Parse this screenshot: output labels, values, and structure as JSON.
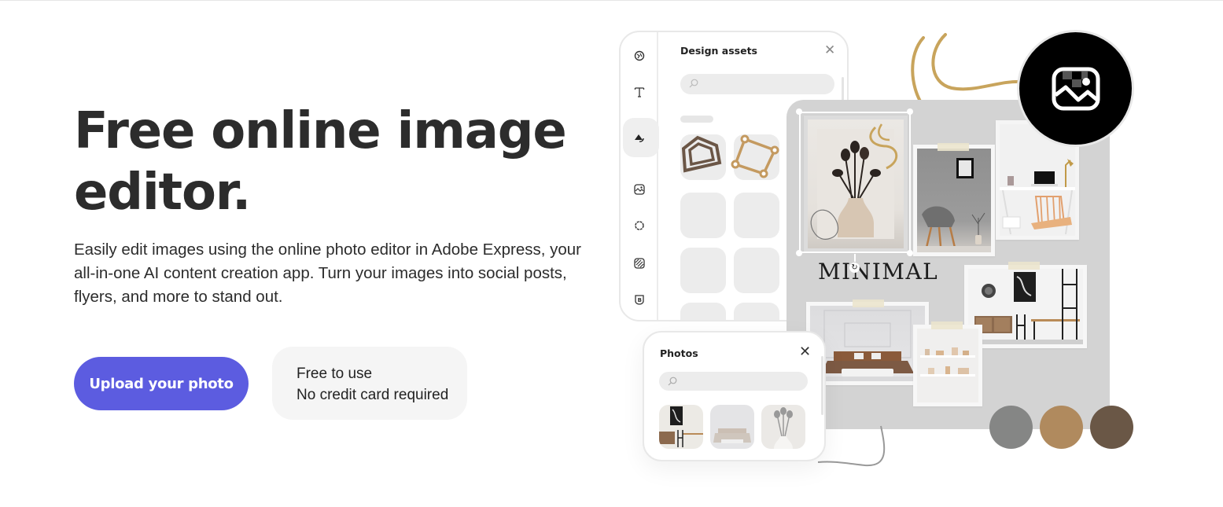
{
  "hero": {
    "title": "Free online image editor.",
    "description": "Easily edit images using the online photo editor in Adobe Express, your all-in-one AI content creation app. Turn your images into social posts, flyers, and more to stand out.",
    "cta_label": "Upload your photo",
    "note_line1": "Free to use",
    "note_line2": "No credit card required"
  },
  "colors": {
    "cta": "#5c5ce0",
    "note_bg": "#f5f5f5",
    "board_bg": "#d3d3d3",
    "gold_accent": "#c8a45c"
  },
  "design_assets_panel": {
    "title": "Design assets",
    "close_icon": "close-icon",
    "search_icon": "search-icon",
    "rail_icons": [
      "templates-icon",
      "text-icon",
      "shapes-icon",
      "image-icon",
      "badge-shape-icon",
      "pattern-icon",
      "brand-icon"
    ],
    "active_rail_icon": "shapes-icon"
  },
  "canvas": {
    "headline_text": "MINIMAL"
  },
  "badge": {
    "icon": "image-icon"
  },
  "color_swatches": [
    "#858685",
    "#b08a5e",
    "#6a5746"
  ],
  "photos_panel": {
    "title": "Photos",
    "close_icon": "close-icon",
    "search_icon": "search-icon",
    "thumbnails": [
      "dining-room-photo",
      "bedroom-photo",
      "vase-photo"
    ]
  }
}
